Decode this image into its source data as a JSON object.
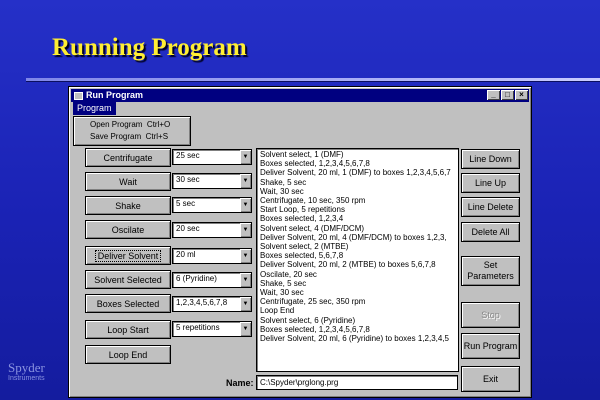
{
  "slide": {
    "title": "Running Program",
    "brand_name": "Spyder",
    "brand_sub": "Instruments"
  },
  "window": {
    "title": "Run Program",
    "controls": {
      "minimize": "_",
      "maximize": "□",
      "close": "×"
    },
    "menu": {
      "program_label": "Program",
      "items": [
        {
          "label": "Open Program",
          "shortcut": "Ctrl+O"
        },
        {
          "label": "Save Program",
          "shortcut": "Ctrl+S"
        }
      ]
    }
  },
  "steps": [
    {
      "button": "Centrifugate",
      "value": "25 sec"
    },
    {
      "button": "Wait",
      "value": "30 sec"
    },
    {
      "button": "Shake",
      "value": "5 sec"
    },
    {
      "button": "Oscilate",
      "value": "20 sec"
    },
    {
      "button": "Deliver Solvent",
      "value": "20 ml"
    },
    {
      "button": "Solvent Selected",
      "value": "6 (Pyridine)"
    },
    {
      "button": "Boxes Selected",
      "value": "1,2,3,4,5,6,7,8"
    },
    {
      "button": "Loop Start",
      "value": "5 repetitions"
    },
    {
      "button": "Loop End"
    }
  ],
  "program_lines": [
    "Solvent select, 1 (DMF)",
    "Boxes selected, 1,2,3,4,5,6,7,8",
    "Deliver Solvent, 20 ml, 1 (DMF) to boxes 1,2,3,4,5,6,7",
    "Shake, 5 sec",
    "Wait, 30 sec",
    "Centrifugate, 10 sec, 350 rpm",
    "Start Loop, 5 repetitions",
    "Boxes selected, 1,2,3,4",
    "Solvent select, 4 (DMF/DCM)",
    "Deliver Solvent, 20 ml, 4 (DMF/DCM) to boxes 1,2,3,",
    "Solvent select, 2 (MTBE)",
    "Boxes selected, 5,6,7,8",
    "Deliver Solvent, 20 ml, 2 (MTBE) to boxes 5,6,7,8",
    "Oscilate, 20 sec",
    "Shake, 5 sec",
    "Wait, 30 sec",
    "Centrifugate, 25 sec, 350 rpm",
    "Loop End",
    "Solvent select, 6 (Pyridine)",
    "Boxes selected, 1,2,3,4,5,6,7,8",
    "Deliver Solvent, 20 ml, 6 (Pyridine) to boxes 1,2,3,4,5"
  ],
  "actions": {
    "line_down": "Line Down",
    "line_up": "Line Up",
    "line_delete": "Line Delete",
    "delete_all": "Delete All",
    "set_parameters": "Set Parameters",
    "stop": "Stop",
    "run_program": "Run Program",
    "exit": "Exit"
  },
  "name_field": {
    "label": "Name:",
    "value": "C:\\Spyder\\prglong.prg"
  }
}
